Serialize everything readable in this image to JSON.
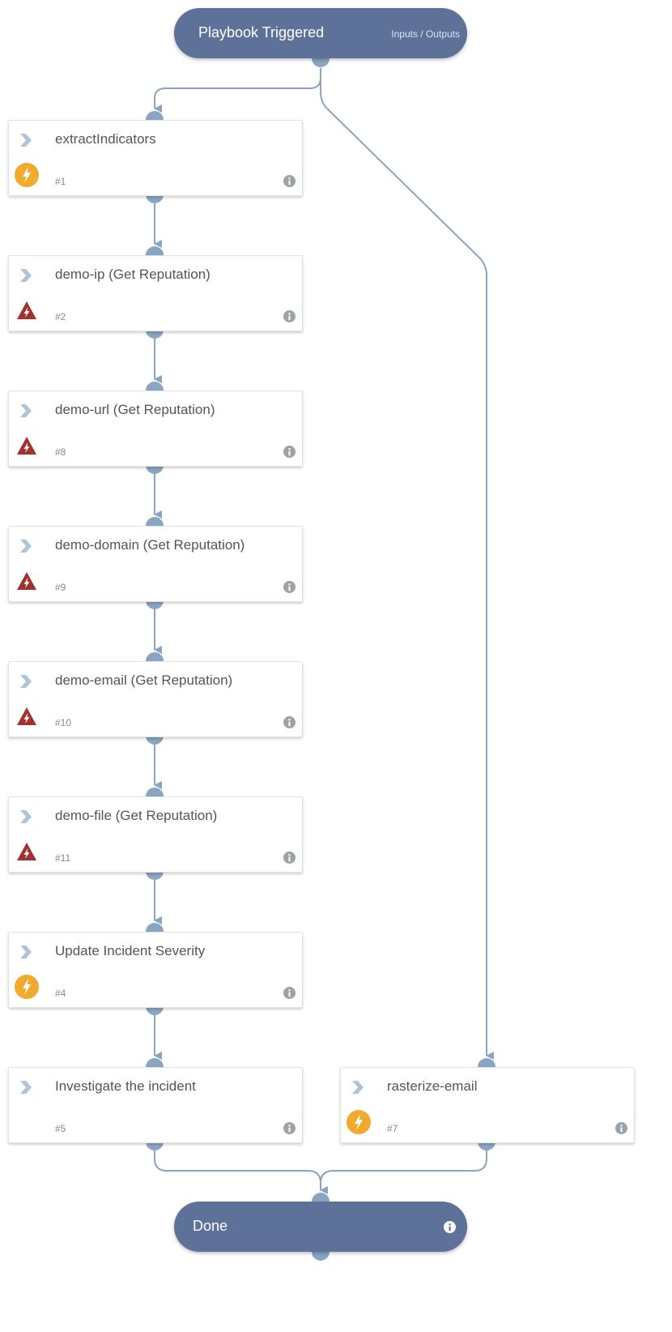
{
  "start": {
    "title": "Playbook Triggered",
    "io_label": "Inputs / Outputs"
  },
  "end": {
    "title": "Done"
  },
  "tasks": [
    {
      "name": "extractIndicators",
      "number": "#1",
      "type": "automation"
    },
    {
      "name": "demo-ip (Get Reputation)",
      "number": "#2",
      "type": "integration"
    },
    {
      "name": "demo-url (Get Reputation)",
      "number": "#8",
      "type": "integration"
    },
    {
      "name": "demo-domain (Get Reputation)",
      "number": "#9",
      "type": "integration"
    },
    {
      "name": "demo-email (Get Reputation)",
      "number": "#10",
      "type": "integration"
    },
    {
      "name": "demo-file (Get Reputation)",
      "number": "#11",
      "type": "integration"
    },
    {
      "name": "Update Incident Severity",
      "number": "#4",
      "type": "automation"
    },
    {
      "name": "Investigate the incident",
      "number": "#5",
      "type": "manual"
    },
    {
      "name": "rasterize-email",
      "number": "#7",
      "type": "automation"
    }
  ],
  "colors": {
    "pill": "#5e7299",
    "edge": "#8aa5c2",
    "automation": "#f0ab2e",
    "integration": "#a0312e"
  }
}
